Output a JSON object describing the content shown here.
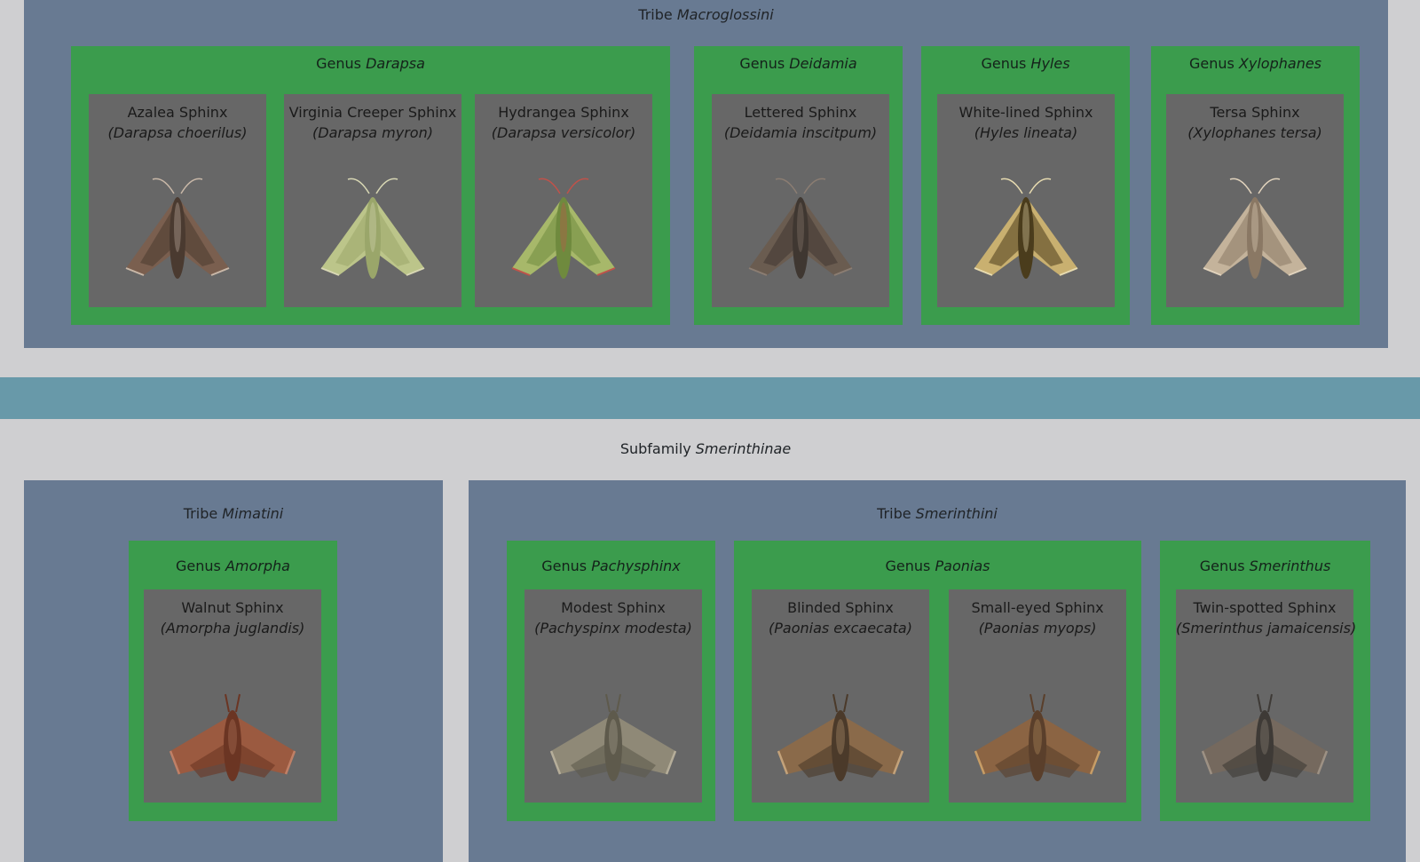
{
  "upper": {
    "tribe": {
      "prefix": "Tribe",
      "name": "Macroglossini"
    },
    "genera": [
      {
        "prefix": "Genus",
        "name": "Darapsa",
        "species": [
          {
            "common": "Azalea Sphinx",
            "scientific": "(Darapsa choerilus)",
            "colors": [
              "#4a3a30",
              "#7a5f4f",
              "#c9b8a8"
            ]
          },
          {
            "common": "Virginia Creeper Sphinx",
            "scientific": "(Darapsa myron)",
            "colors": [
              "#9aa66a",
              "#bcc58a",
              "#d8d7b4"
            ]
          },
          {
            "common": "Hydrangea Sphinx",
            "scientific": "(Darapsa versicolor)",
            "colors": [
              "#6f8a3e",
              "#a7b86a",
              "#c0524a"
            ]
          }
        ]
      },
      {
        "prefix": "Genus",
        "name": "Deidamia",
        "species": [
          {
            "common": "Lettered Sphinx",
            "scientific": "(Deidamia inscitpum)",
            "colors": [
              "#3f3731",
              "#6a5c50",
              "#8b7d72"
            ]
          }
        ]
      },
      {
        "prefix": "Genus",
        "name": "Hyles",
        "species": [
          {
            "common": "White-lined Sphinx",
            "scientific": "(Hyles lineata)",
            "colors": [
              "#4a3c1c",
              "#c9b070",
              "#e7dbb0"
            ]
          }
        ]
      },
      {
        "prefix": "Genus",
        "name": "Xylophanes",
        "species": [
          {
            "common": "Tersa Sphinx",
            "scientific": "(Xylophanes tersa)",
            "colors": [
              "#8a7864",
              "#c4b39b",
              "#e1d3bd"
            ]
          }
        ]
      }
    ]
  },
  "subfamily": {
    "prefix": "Subfamily",
    "name": "Smerinthinae"
  },
  "lower": {
    "tribes": [
      {
        "prefix": "Tribe",
        "name": "Mimatini",
        "genera": [
          {
            "prefix": "Genus",
            "name": "Amorpha",
            "species": [
              {
                "common": "Walnut Sphinx",
                "scientific": "(Amorpha juglandis)",
                "colors": [
                  "#6b3523",
                  "#9b5a40",
                  "#c08066"
                ]
              }
            ]
          }
        ]
      },
      {
        "prefix": "Tribe",
        "name": "Smerinthini",
        "genera": [
          {
            "prefix": "Genus",
            "name": "Pachysphinx",
            "species": [
              {
                "common": "Modest Sphinx",
                "scientific": "(Pachyspinx modesta)",
                "colors": [
                  "#5e5a4c",
                  "#8f8977",
                  "#b6ae9a"
                ]
              }
            ]
          },
          {
            "prefix": "Genus",
            "name": "Paonias",
            "species": [
              {
                "common": "Blinded Sphinx",
                "scientific": "(Paonias excaecata)",
                "colors": [
                  "#4b3a2a",
                  "#8a6a4a",
                  "#c3a27a"
                ]
              },
              {
                "common": "Small-eyed Sphinx",
                "scientific": "(Paonias myops)",
                "colors": [
                  "#5a3f2b",
                  "#8b6443",
                  "#c79d66"
                ]
              }
            ]
          },
          {
            "prefix": "Genus",
            "name": "Smerinthus",
            "species": [
              {
                "common": "Twin-spotted Sphinx",
                "scientific": "(Smerinthus jamaicensis)",
                "colors": [
                  "#3e3a36",
                  "#75695e",
                  "#9d9184"
                ]
              }
            ]
          }
        ]
      }
    ]
  }
}
